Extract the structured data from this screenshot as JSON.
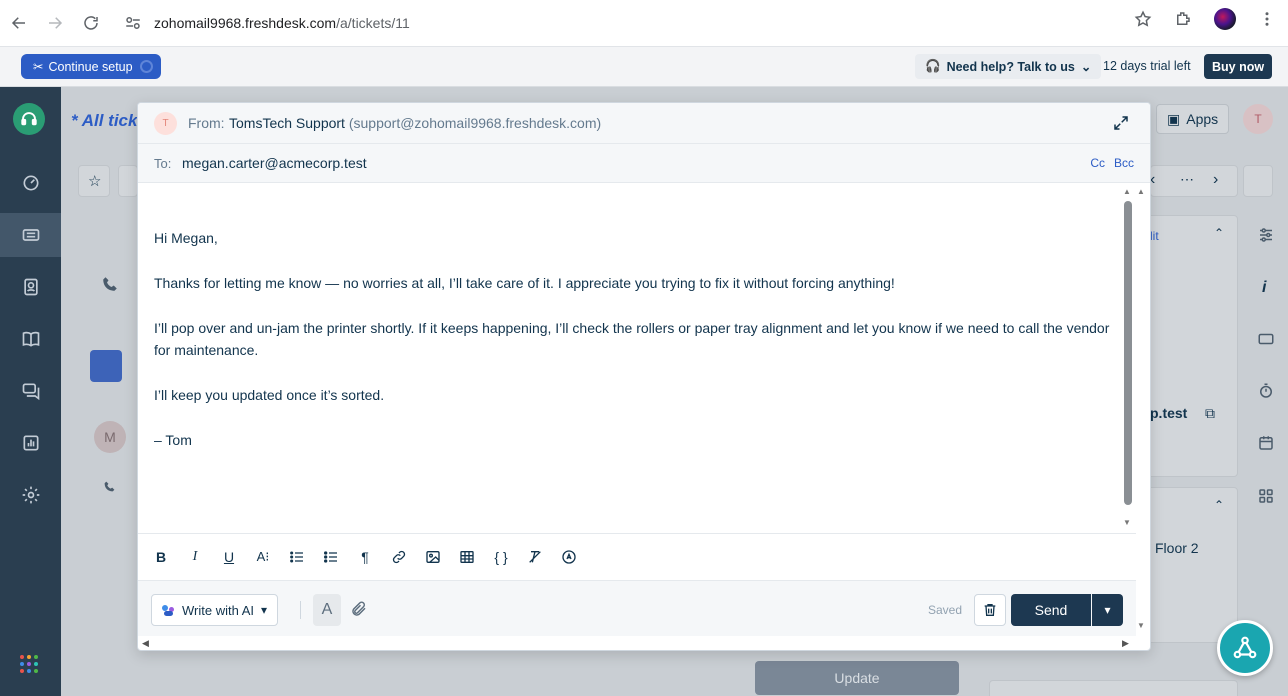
{
  "browser": {
    "url_host": "zohomail9968.freshdesk.com",
    "url_path": "/a/tickets/11"
  },
  "appbar": {
    "setup_label": "Continue setup",
    "help_label": "Need help? Talk to us",
    "trial_label": "12 days trial left",
    "buy_label": "Buy now"
  },
  "background": {
    "title": "* All ticke",
    "apps_label": "Apps",
    "avatar_top_initial": "T",
    "contact_email_fragment": "p.test",
    "location_fragment": "Floor 2",
    "link_fragment": "lit",
    "avatar_initial": "M",
    "update_label": "Update"
  },
  "reply": {
    "from_label": "From:",
    "from_name": "TomsTech Support",
    "from_email": "(support@zohomail9968.freshdesk.com)",
    "from_avatar_initial": "T",
    "to_label": "To:",
    "to_value": "megan.carter@acmecorp.test",
    "cc_label": "Cc",
    "bcc_label": "Bcc",
    "body": {
      "greeting": "Hi Megan,",
      "para1": "Thanks for letting me know — no worries at all, I’ll take care of it. I appreciate you trying to fix it without forcing anything!",
      "para2": "I’ll pop over and un-jam the printer shortly. If it keeps happening, I’ll check the rollers or paper tray alignment and let you know if we need to call the vendor for maintenance.",
      "para3": "I’ll keep you updated once it’s sorted.",
      "signature": "– Tom"
    },
    "write_ai_label": "Write with AI",
    "saved_label": "Saved",
    "send_label": "Send"
  },
  "colors": {
    "brand_blue": "#2c5cc5",
    "navy": "#1d3851",
    "sidebar": "#2a3e50",
    "fab": "#1aa6b0"
  }
}
